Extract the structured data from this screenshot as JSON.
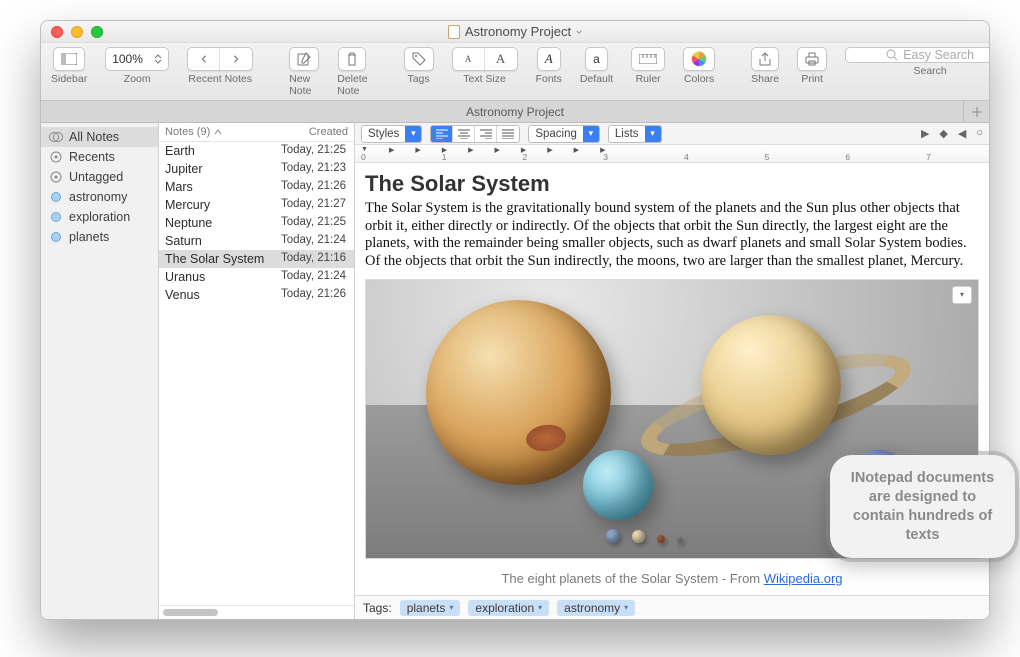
{
  "window": {
    "title": "Astronomy Project"
  },
  "toolbar": {
    "sidebar": "Sidebar",
    "zoom": "Zoom",
    "zoom_value": "100%",
    "recent": "Recent Notes",
    "new_note": "New Note",
    "delete_note": "Delete Note",
    "tags": "Tags",
    "text_size": "Text Size",
    "fonts": "Fonts",
    "default": "Default",
    "ruler": "Ruler",
    "colors": "Colors",
    "share": "Share",
    "print": "Print",
    "search": "Search",
    "search_placeholder": "Easy Search"
  },
  "tab": "Astronomy Project",
  "sidebar": {
    "items": [
      {
        "label": "All Notes",
        "icon": "circles"
      },
      {
        "label": "Recents",
        "icon": "gear"
      },
      {
        "label": "Untagged",
        "icon": "gear"
      },
      {
        "label": "astronomy",
        "icon": "tag"
      },
      {
        "label": "exploration",
        "icon": "tag"
      },
      {
        "label": "planets",
        "icon": "tag"
      }
    ]
  },
  "noteslist": {
    "header_notes": "Notes (9)",
    "header_created": "Created",
    "rows": [
      {
        "title": "Earth",
        "date": "Today, 21:25"
      },
      {
        "title": "Jupiter",
        "date": "Today, 21:23"
      },
      {
        "title": "Mars",
        "date": "Today, 21:26"
      },
      {
        "title": "Mercury",
        "date": "Today, 21:27"
      },
      {
        "title": "Neptune",
        "date": "Today, 21:25"
      },
      {
        "title": "Saturn",
        "date": "Today, 21:24"
      },
      {
        "title": "The Solar System",
        "date": "Today, 21:16"
      },
      {
        "title": "Uranus",
        "date": "Today, 21:24"
      },
      {
        "title": "Venus",
        "date": "Today, 21:26"
      }
    ],
    "selected_index": 6
  },
  "editorbar": {
    "styles": "Styles",
    "spacing": "Spacing",
    "lists": "Lists"
  },
  "ruler_ticks": [
    "0",
    "1",
    "2",
    "3",
    "4",
    "5",
    "6",
    "7"
  ],
  "note": {
    "heading": "The Solar System",
    "body": "The Solar System is the gravitationally bound system of the planets and the Sun plus other objects that orbit it, either directly or indirectly. Of the objects that orbit the Sun directly, the largest eight are the planets, with the remainder being smaller objects, such as dwarf planets and small Solar System bodies. Of the objects that orbit the Sun indirectly, the moons, two are larger than the smallest planet, Mercury.",
    "caption_prefix": "The eight planets of the Solar System - From ",
    "caption_link": "Wikipedia.org"
  },
  "tags": {
    "label": "Tags:",
    "chips": [
      "planets",
      "exploration",
      "astronomy"
    ]
  },
  "balloon": "INotepad documents are designed to contain hundreds of texts"
}
